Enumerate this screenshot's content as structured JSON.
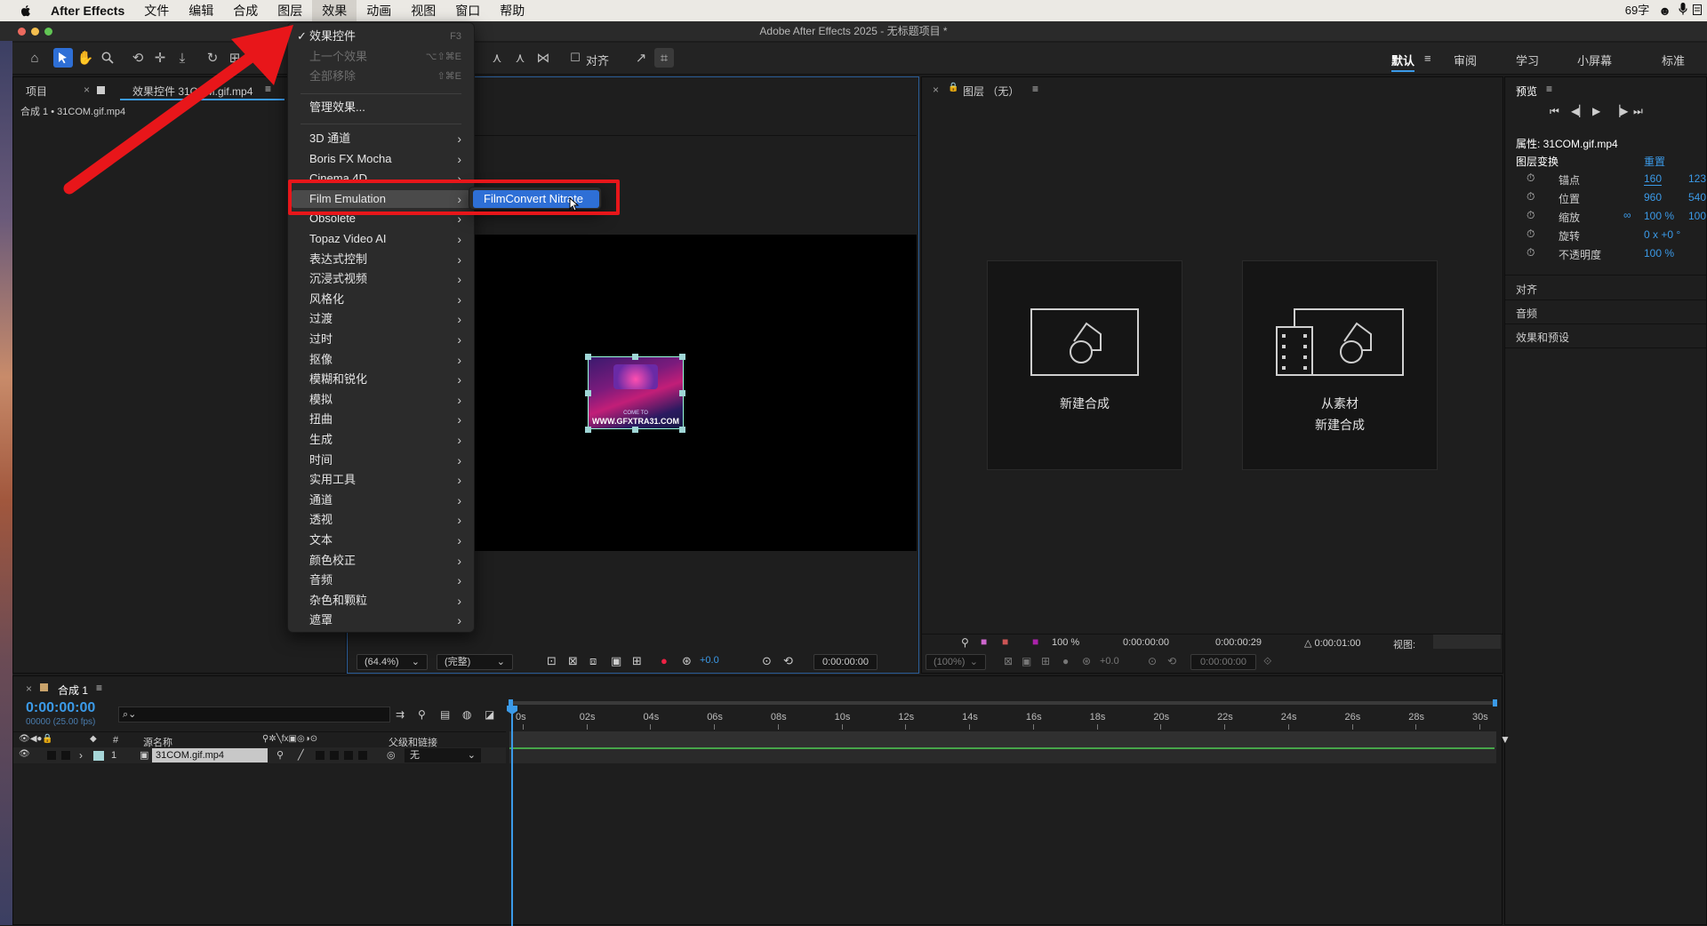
{
  "menubar": {
    "app": "After Effects",
    "items": [
      "文件",
      "编辑",
      "合成",
      "图层",
      "效果",
      "动画",
      "视图",
      "窗口",
      "帮助"
    ],
    "active": "效果",
    "status_wordcount": "69字"
  },
  "window_title": "Adobe After Effects 2025 - 无标题项目 *",
  "toolbar": {
    "snap_label": "对齐",
    "workspaces": [
      "默认",
      "审阅",
      "学习",
      "小屏幕",
      "标准"
    ],
    "active_workspace": "默认"
  },
  "project_panel": {
    "tab_project": "项目",
    "tab_effects": "效果控件 31COM.gif.mp4",
    "breadcrumb": "合成 1 • 31COM.gif.mp4"
  },
  "effects_menu": {
    "effect_controls": "效果控件",
    "effect_controls_shortcut": "F3",
    "previous_effect": "上一个效果",
    "previous_effect_shortcut": "⌥⇧⌘E",
    "remove_all": "全部移除",
    "remove_all_shortcut": "⇧⌘E",
    "manage_effects": "管理效果...",
    "categories": [
      "3D 通道",
      "Boris FX Mocha",
      "Cinema 4D",
      "Film Emulation",
      "Obsolete",
      "Topaz Video AI",
      "表达式控制",
      "沉浸式视频",
      "风格化",
      "过渡",
      "过时",
      "抠像",
      "模糊和锐化",
      "模拟",
      "扭曲",
      "生成",
      "时间",
      "实用工具",
      "通道",
      "透视",
      "文本",
      "颜色校正",
      "音频",
      "杂色和颗粒",
      "遮罩"
    ],
    "highlighted": "Film Emulation"
  },
  "submenu": {
    "item": "FilmConvert Nitrate"
  },
  "composition": {
    "logo_line1": "COME TO",
    "logo_line2": "WWW.GFXTRA31.COM",
    "zoom": "(64.4%)",
    "quality": "(完整)",
    "exposure": "+0.0",
    "timecode": "0:00:00:00"
  },
  "layer_panel": {
    "title": "图层 （无）",
    "new_comp": "新建合成",
    "from_footage_line1": "从素材",
    "from_footage_line2": "新建合成",
    "zoom_pct": "100 %",
    "in_point": "0:00:00:00",
    "out_point": "0:00:00:29",
    "duration": "△ 0:00:01:00",
    "view_label": "视图:",
    "zoom2": "(100%)",
    "exposure": "+0.0",
    "timecode": "0:00:00:00"
  },
  "right_panel": {
    "preview": "预览",
    "properties_title": "属性: 31COM.gif.mp4",
    "layer_transform": "图层变换",
    "reset": "重置",
    "anchor": {
      "label": "锚点",
      "x": "160",
      "y": "123"
    },
    "position": {
      "label": "位置",
      "x": "960",
      "y": "540"
    },
    "scale": {
      "label": "缩放",
      "x": "100 %",
      "y": "100"
    },
    "rotation": {
      "label": "旋转",
      "value": "0 x +0 °"
    },
    "opacity": {
      "label": "不透明度",
      "value": "100 %"
    },
    "sections": [
      "对齐",
      "音频",
      "效果和预设"
    ]
  },
  "timeline": {
    "tab": "合成 1",
    "timecode": "0:00:00:00",
    "fps": "00000 (25.00 fps)",
    "col_source": "源名称",
    "col_parent": "父级和链接",
    "col_num": "#",
    "layer": {
      "num": "1",
      "name": "31COM.gif.mp4",
      "parent": "无"
    },
    "ticks": [
      "0s",
      "02s",
      "04s",
      "06s",
      "08s",
      "10s",
      "12s",
      "14s",
      "16s",
      "18s",
      "20s",
      "22s",
      "24s",
      "26s",
      "28s",
      "30s"
    ]
  },
  "colors": {
    "accent_red": "#e8161a",
    "highlight_blue": "#2e6fd6",
    "timecode_blue": "#3b9ae8"
  }
}
